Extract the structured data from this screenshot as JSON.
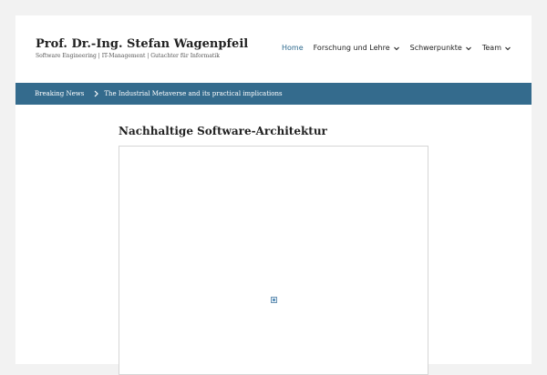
{
  "site": {
    "title": "Prof. Dr.-Ing. Stefan Wagenpfeil",
    "description": "Software Engineering | IT-Management | Gutachter für Informatik"
  },
  "nav": {
    "home": "Home",
    "research": "Forschung und Lehre",
    "focus": "Schwerpunkte",
    "team": "Team"
  },
  "ticker": {
    "label": "Breaking News",
    "item": "The Industrial Metaverse and its practical implications"
  },
  "main": {
    "title": "Nachhaltige Software-Architektur",
    "embed_icon": "broken-image-icon"
  },
  "colors": {
    "accent": "#346b8d",
    "nav_active": "#2e6a8e",
    "background": "#f2f2f2"
  }
}
